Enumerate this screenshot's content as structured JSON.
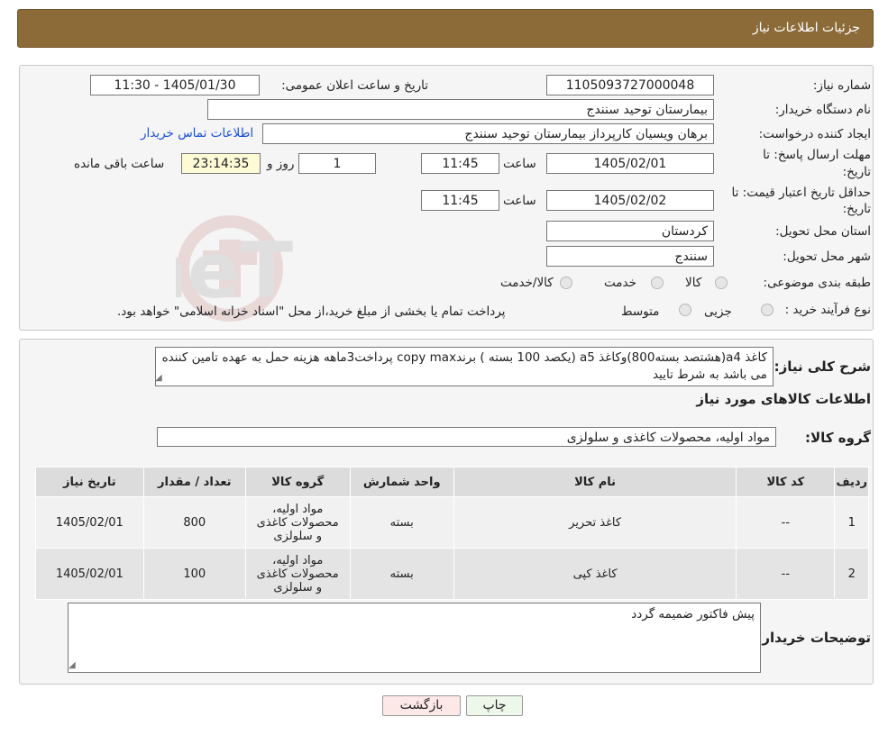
{
  "header": {
    "title": "جزئیات اطلاعات نیاز"
  },
  "info": {
    "need_number_label": "شماره نیاز:",
    "need_number": "1105093727000048",
    "announce_label": "تاریخ و ساعت اعلان عمومی:",
    "announce_value": "1405/01/30 - 11:30",
    "buyer_org_label": "نام دستگاه خریدار:",
    "buyer_org": "بیمارستان توحید سنندج",
    "creator_label": "ایجاد کننده درخواست:",
    "creator": "برهان ویسیان کارپرداز بیمارستان توحید سنندج",
    "contact_link": "اطلاعات تماس خریدار",
    "deadline_label_1": "مهلت ارسال پاسخ: تا",
    "deadline_label_2": "تاریخ:",
    "deadline_date": "1405/02/01",
    "time_label": "ساعت",
    "deadline_time": "11:45",
    "days_value": "1",
    "days_label": "روز و",
    "remaining_time": "23:14:35",
    "remaining_label": "ساعت باقی مانده",
    "validity_label_1": "حداقل تاریخ اعتبار قیمت: تا",
    "validity_label_2": "تاریخ:",
    "validity_date": "1405/02/02",
    "validity_time": "11:45",
    "province_label": "استان محل تحویل:",
    "province": "کردستان",
    "city_label": "شهر محل تحویل:",
    "city": "سنندج",
    "category_label": "طبقه بندی موضوعی:",
    "category_options": [
      "کالا",
      "خدمت",
      "کالا/خدمت"
    ],
    "process_label": "نوع فرآیند خرید :",
    "process_options": [
      "جزیی",
      "متوسط"
    ],
    "process_note": "پرداخت تمام یا بخشی از مبلغ خرید،از محل \"اسناد خزانه اسلامی\" خواهد بود."
  },
  "summary": {
    "label": "شرح کلی نیاز:",
    "text": "کاغذ a4(هشتصد بسته800)وکاغذ a5 (یکصد 100 بسته ) برندcopy max پرداخت3ماهه هزینه حمل به عهده تامین کننده می باشد به شرط تایید",
    "goods_info_title": "اطلاعات کالاهای مورد نیاز",
    "goods_group_label": "گروه کالا:",
    "goods_group": "مواد اولیه، محصولات کاغذی و سلولزی"
  },
  "table": {
    "headers": [
      "ردیف",
      "کد کالا",
      "نام کالا",
      "واحد شمارش",
      "گروه کالا",
      "تعداد / مقدار",
      "تاریخ نیاز"
    ],
    "rows": [
      {
        "row": "1",
        "code": "--",
        "name": "کاغذ تحریر",
        "unit": "بسته",
        "group": "مواد اولیه، محصولات کاغذی و سلولزی",
        "qty": "800",
        "date": "1405/02/01"
      },
      {
        "row": "2",
        "code": "--",
        "name": "کاغذ کپی",
        "unit": "بسته",
        "group": "مواد اولیه، محصولات کاغذی و سلولزی",
        "qty": "100",
        "date": "1405/02/01"
      }
    ]
  },
  "buyer_notes": {
    "label": "توضیحات خریدار:",
    "text": "پیش فاکتور ضمیمه گردد"
  },
  "buttons": {
    "print": "چاپ",
    "back": "بازگشت"
  },
  "watermark": {
    "text": "AriaTender.neT"
  },
  "colors": {
    "header_bg": "#8c6b39",
    "link": "#1a4fd6",
    "remaining_bg": "#fdfbd6",
    "back_button_bg": "#fde8e8",
    "print_button_bg": "#eef8ea"
  }
}
